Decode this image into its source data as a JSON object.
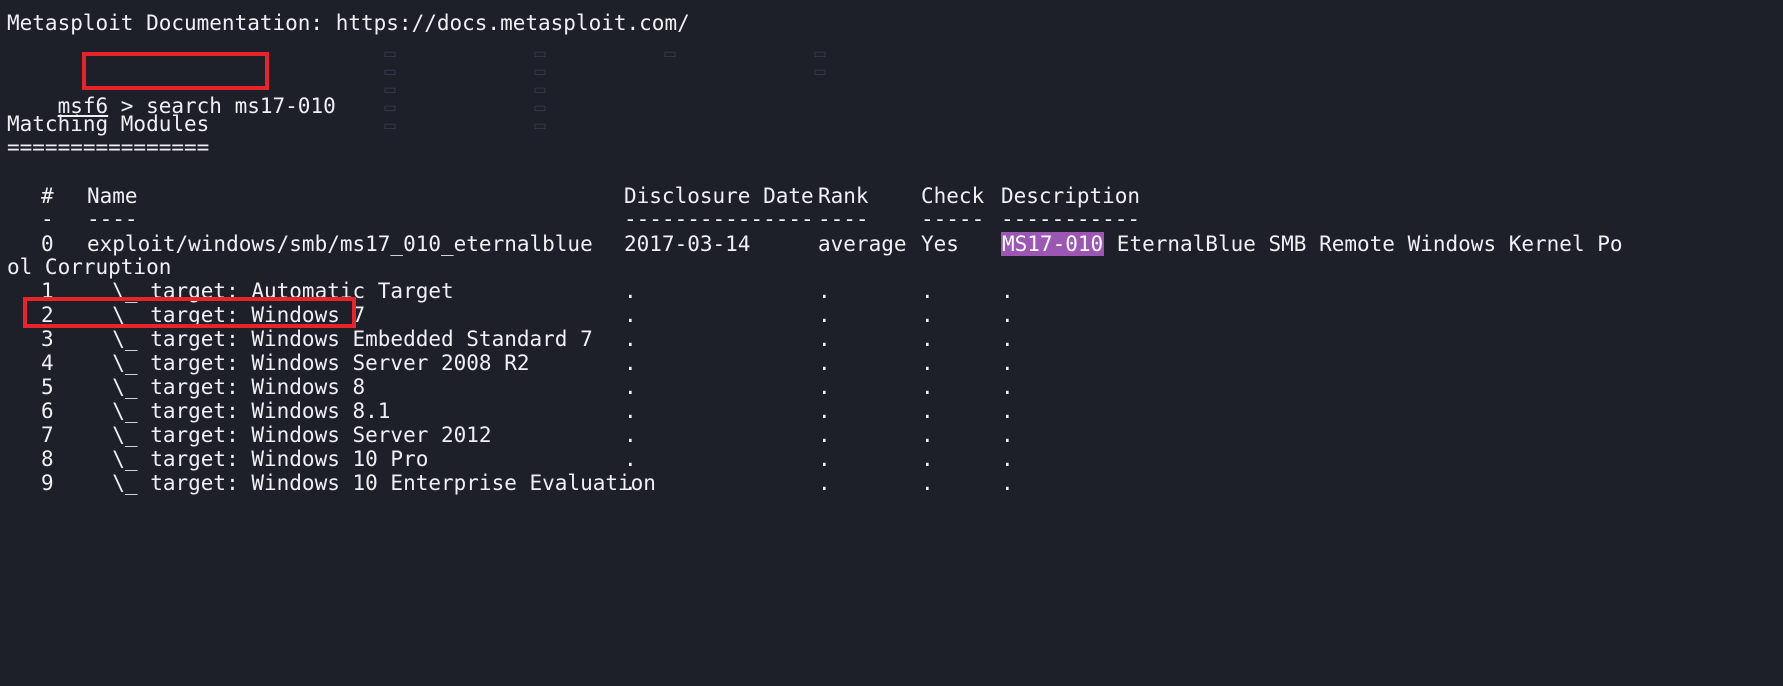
{
  "header": "Metasploit Documentation: https://docs.metasploit.com/",
  "prompt": {
    "name": "msf6",
    "sep": " > ",
    "command": "search ms17-010"
  },
  "section_title": "Matching Modules",
  "section_rule": "================",
  "table": {
    "headers": {
      "num": "#",
      "name": "Name",
      "date": "Disclosure Date",
      "rank": "Rank",
      "check": "Check",
      "desc": "Description"
    },
    "dashes": {
      "num": "-",
      "name": "----",
      "date": "---------------",
      "rank": "----",
      "check": "-----",
      "desc": "-----------"
    },
    "main": {
      "num": "0",
      "name": "exploit/windows/smb/ms17_010_eternalblue",
      "date": "2017-03-14",
      "rank": "average",
      "check": "Yes",
      "desc_highlight": "MS17-010",
      "desc_rest": " EternalBlue SMB Remote Windows Kernel Po",
      "desc_wrap": "ol Corruption"
    },
    "targets": [
      {
        "num": "1",
        "name": "  \\_ target: Automatic Target",
        "date": ".",
        "rank": ".",
        "check": ".",
        "desc": "."
      },
      {
        "num": "2",
        "name": "  \\_ target: Windows 7",
        "date": ".",
        "rank": ".",
        "check": ".",
        "desc": "."
      },
      {
        "num": "3",
        "name": "  \\_ target: Windows Embedded Standard 7",
        "date": ".",
        "rank": ".",
        "check": ".",
        "desc": "."
      },
      {
        "num": "4",
        "name": "  \\_ target: Windows Server 2008 R2",
        "date": ".",
        "rank": ".",
        "check": ".",
        "desc": "."
      },
      {
        "num": "5",
        "name": "  \\_ target: Windows 8",
        "date": ".",
        "rank": ".",
        "check": ".",
        "desc": "."
      },
      {
        "num": "6",
        "name": "  \\_ target: Windows 8.1",
        "date": ".",
        "rank": ".",
        "check": ".",
        "desc": "."
      },
      {
        "num": "7",
        "name": "  \\_ target: Windows Server 2012",
        "date": ".",
        "rank": ".",
        "check": ".",
        "desc": "."
      },
      {
        "num": "8",
        "name": "  \\_ target: Windows 10 Pro",
        "date": ".",
        "rank": ".",
        "check": ".",
        "desc": "."
      },
      {
        "num": "9",
        "name": "  \\_ target: Windows 10 Enterprise Evaluation",
        "date": ".",
        "rank": ".",
        "check": ".",
        "desc": "."
      }
    ]
  },
  "colors": {
    "background": "#1d1f29",
    "text": "#eef0f4",
    "highlight": "#9b57b3",
    "annotation": "#e8232a"
  }
}
